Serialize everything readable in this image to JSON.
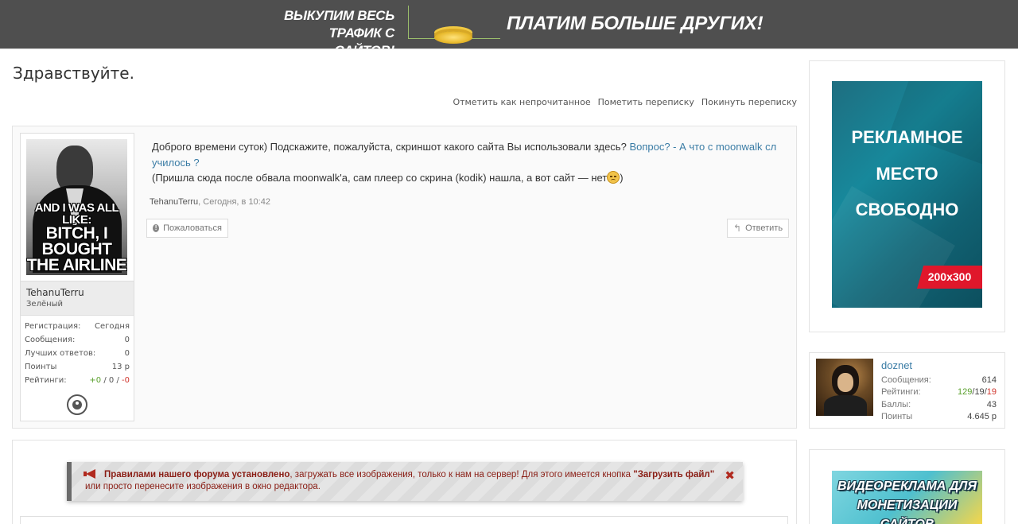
{
  "banner": {
    "left_line1": "ВЫКУПИМ ВЕСЬ",
    "left_line2": "ТРАФИК С САЙТОВ!",
    "right_text": "ПЛАТИМ БОЛЬШЕ ДРУГИХ!"
  },
  "page": {
    "title": "Здравствуйте."
  },
  "conversation_actions": {
    "mark_unread": "Отметить как непрочитанное",
    "flag": "Пометить переписку",
    "leave": "Покинуть переписку"
  },
  "message": {
    "text_part1": "Доброго времени суток) Подскажите, пожалуйста, скриншот какого сайта Вы использовали здесь? ",
    "link_text": "Вопрос? - А что с moonwalk сл училось ?",
    "text_part2": "(Пришла сюда после обвала moonwalk'а, сам плеер со скрина (kodik) нашла, а вот сайт — нет",
    "text_part3": ")",
    "author": "TehanuTerru",
    "date": ", Сегодня, в 10:42",
    "report_label": "Пожаловаться",
    "reply_label": "Ответить"
  },
  "author_box": {
    "avatar_caption_line1": "AND I WAS ALL LIKE:",
    "avatar_caption_line2": "BITCH, I BOUGHT",
    "avatar_caption_line3": "THE AIRLINE",
    "name": "TehanuTerru",
    "group": "Зелёный",
    "stats": [
      {
        "label": "Регистрация:",
        "value": "Сегодня"
      },
      {
        "label": "Сообщения:",
        "value": "0"
      },
      {
        "label": "Лучших ответов:",
        "value": "0"
      },
      {
        "label": "Поинты",
        "value": "13 р"
      }
    ],
    "ratings_label": "Рейтинги:",
    "ratings_pos": "+0",
    "ratings_sep1": " / ",
    "ratings_neu": "0",
    "ratings_sep2": " / ",
    "ratings_neg": "-0"
  },
  "notice": {
    "bold_text": "Правилами нашего форума установлено",
    "text": ", загружать все изображения, только к нам на сервер! Для этого имеется кнопка ",
    "button_name": "\"Загрузить файл\"",
    "text_end": " или просто перенесите изображения в окно редактора."
  },
  "sidebar": {
    "ad1_line1": "РЕКЛАМНОЕ",
    "ad1_line2": "МЕСТО",
    "ad1_line3": "СВОБОДНО",
    "ad1_size": "200x300",
    "user": {
      "name": "doznet",
      "messages_label": "Сообщения:",
      "messages": "614",
      "ratings_label": "Рейтинги:",
      "ratings_pos": "129",
      "ratings_neu": "19",
      "ratings_neg": "19",
      "points_label": "Баллы:",
      "points": "43",
      "pointy_label": "Поинты",
      "pointy": "4.645 р"
    },
    "ad2_line1": "ВИДЕОРЕКЛАМА ДЛЯ",
    "ad2_line2": "МОНЕТИЗАЦИИ САЙТОВ"
  },
  "colors": {
    "link": "#3a7ca5",
    "positive": "#5aa02c",
    "negative": "#d0342c",
    "notice_text": "#8a1d14",
    "ad_tag": "#e0172b"
  }
}
